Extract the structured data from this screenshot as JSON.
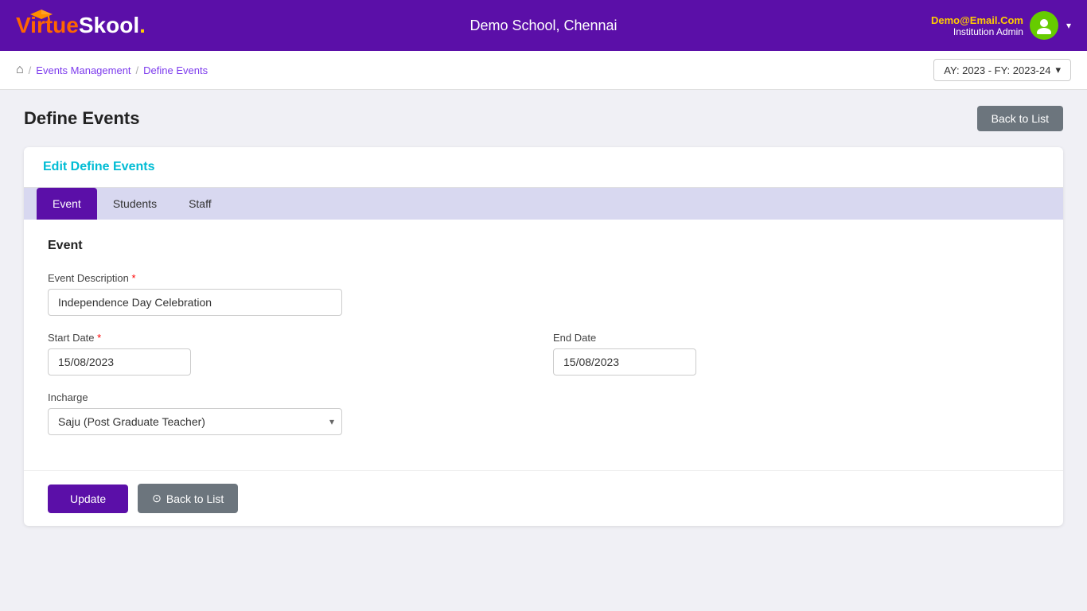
{
  "header": {
    "logo": {
      "virtue": "Virtue",
      "skool": "Skool",
      "dot": "."
    },
    "school_name": "Demo School, Chennai",
    "user_email": "Demo@Email.Com",
    "user_role": "Institution Admin"
  },
  "breadcrumb": {
    "home_icon": "🏠",
    "events_management": "Events Management",
    "define_events": "Define Events"
  },
  "ay_selector": {
    "label": "AY: 2023 - FY: 2023-24"
  },
  "page": {
    "title": "Define Events",
    "back_to_list_top": "Back to List"
  },
  "form_card": {
    "edit_title": "Edit Define Events"
  },
  "tabs": [
    {
      "id": "event",
      "label": "Event",
      "active": true
    },
    {
      "id": "students",
      "label": "Students",
      "active": false
    },
    {
      "id": "staff",
      "label": "Staff",
      "active": false
    }
  ],
  "event_form": {
    "section_title": "Event",
    "event_description_label": "Event Description",
    "event_description_value": "Independence Day Celebration",
    "event_description_placeholder": "",
    "start_date_label": "Start Date",
    "start_date_value": "15/08/2023",
    "end_date_label": "End Date",
    "end_date_value": "15/08/2023",
    "incharge_label": "Incharge",
    "incharge_value": "Saju (Post Graduate Teacher)",
    "incharge_options": [
      "Saju (Post Graduate Teacher)"
    ]
  },
  "form_actions": {
    "update_label": "Update",
    "back_to_list_label": "Back to List",
    "back_icon": "⊙"
  }
}
